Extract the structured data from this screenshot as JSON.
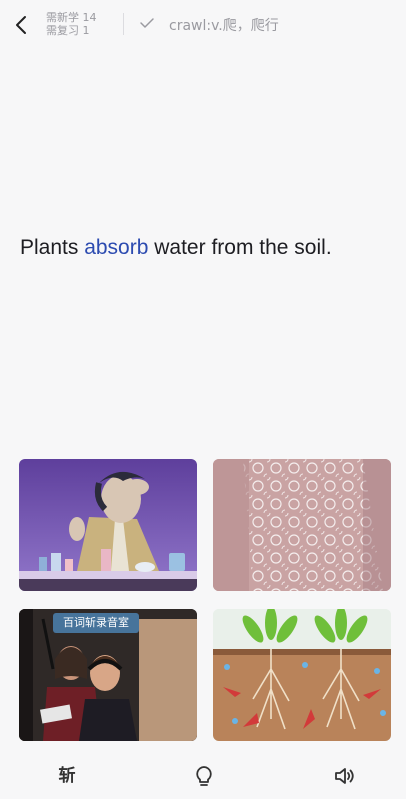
{
  "header": {
    "new_count_label": "需新学 14",
    "review_count_label": "需复习 1",
    "previous_word": "crawl:v.爬，爬行",
    "icons": {
      "back": "chevron-left-icon",
      "check": "check-icon"
    }
  },
  "question": {
    "before": "Plants ",
    "keyword": "absorb",
    "after": " water from the soil.",
    "keyword_color": "#2c4bb0"
  },
  "options": [
    {
      "caption": ""
    },
    {
      "caption": ""
    },
    {
      "caption": "百词斩录音室"
    },
    {
      "caption": ""
    }
  ],
  "toolbar": {
    "zhan_label": "斩",
    "icons": {
      "hint": "lightbulb-icon",
      "sound": "speaker-icon"
    }
  }
}
